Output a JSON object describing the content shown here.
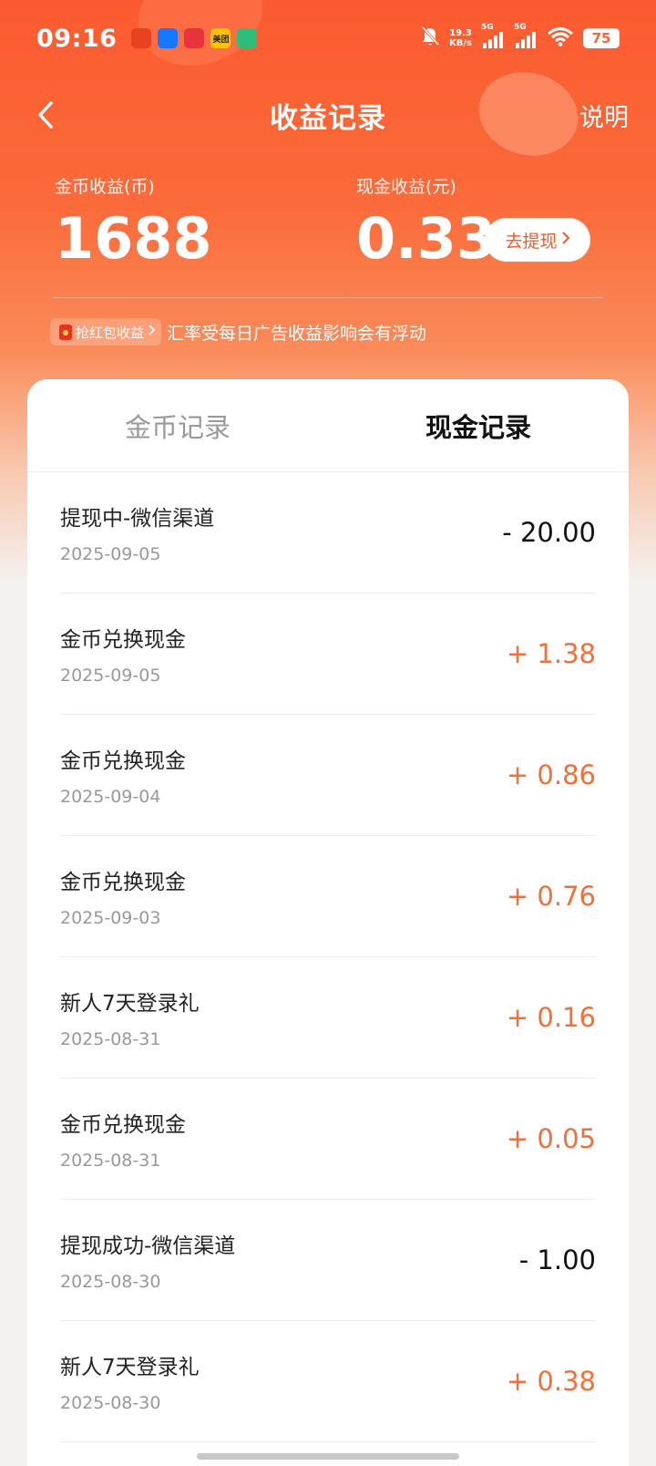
{
  "status_bar": {
    "time": "09:16",
    "net_speed_value": "19.3",
    "net_speed_unit": "KB/s",
    "sim1": "5G",
    "sim2": "5G",
    "battery": "75",
    "app_icons": [
      {
        "name": "taobao-icon",
        "color": "#e8421e",
        "text": ""
      },
      {
        "name": "alipay-icon",
        "color": "#1677ff",
        "text": ""
      },
      {
        "name": "pinduoduo-icon",
        "color": "#e8333c",
        "text": ""
      },
      {
        "name": "meituan-icon",
        "color": "#ffc300",
        "text": "美团"
      },
      {
        "name": "app-icon",
        "color": "#2dbf7a",
        "text": ""
      }
    ]
  },
  "header": {
    "title": "收益记录",
    "right_link": "说明"
  },
  "summary": {
    "coin_label": "金币收益(币)",
    "coin_value": "1688",
    "cash_label": "现金收益(元)",
    "cash_value": "0.33",
    "withdraw_label": "去提现"
  },
  "note": {
    "tag_label": "抢红包收益",
    "text": "汇率受每日广告收益影响会有浮动"
  },
  "tabs": [
    {
      "label": "金币记录",
      "active": false
    },
    {
      "label": "现金记录",
      "active": true
    }
  ],
  "records": [
    {
      "name": "提现中-微信渠道",
      "date": "2025-09-05",
      "amount": "- 20.00",
      "type": "neg"
    },
    {
      "name": "金币兑换现金",
      "date": "2025-09-05",
      "amount": "+ 1.38",
      "type": "pos"
    },
    {
      "name": "金币兑换现金",
      "date": "2025-09-04",
      "amount": "+ 0.86",
      "type": "pos"
    },
    {
      "name": "金币兑换现金",
      "date": "2025-09-03",
      "amount": "+ 0.76",
      "type": "pos"
    },
    {
      "name": "新人7天登录礼",
      "date": "2025-08-31",
      "amount": "+ 0.16",
      "type": "pos"
    },
    {
      "name": "金币兑换现金",
      "date": "2025-08-31",
      "amount": "+ 0.05",
      "type": "pos"
    },
    {
      "name": "提现成功-微信渠道",
      "date": "2025-08-30",
      "amount": "- 1.00",
      "type": "neg"
    },
    {
      "name": "新人7天登录礼",
      "date": "2025-08-30",
      "amount": "+ 0.38",
      "type": "pos"
    }
  ],
  "colors": {
    "accent": "#fb5a2f",
    "positive_amount": "#f0703a",
    "negative_amount": "#111111"
  }
}
